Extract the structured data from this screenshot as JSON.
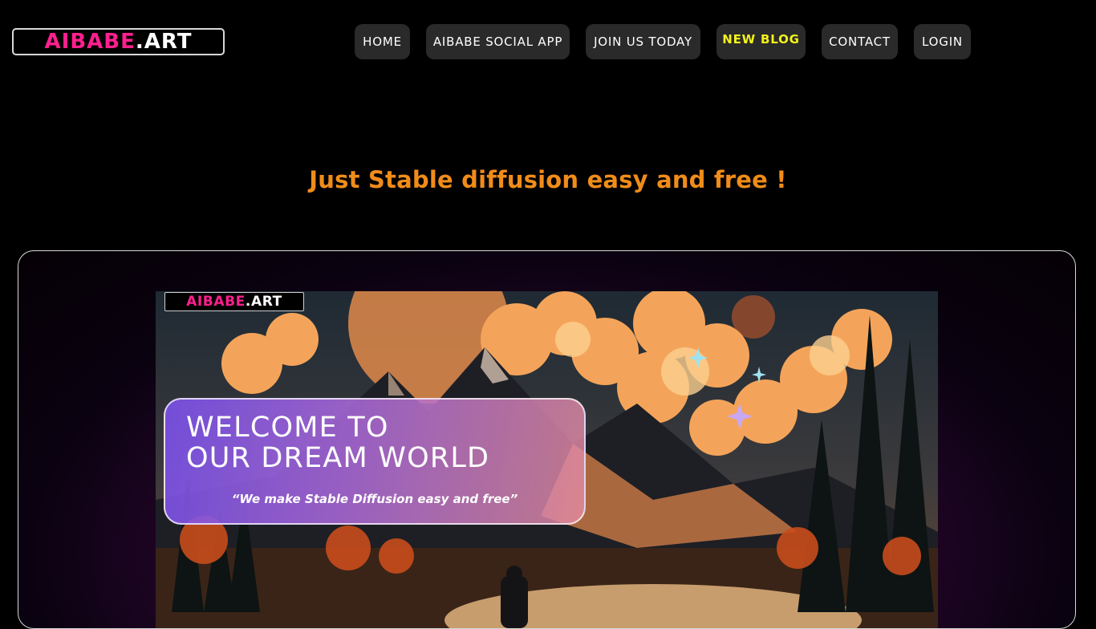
{
  "header": {
    "logo": {
      "part1": "AIBABE",
      "part2": ".ART"
    },
    "nav": [
      {
        "label": "HOME"
      },
      {
        "label": "AIBABE SOCIAL APP"
      },
      {
        "label": "JOIN US TODAY"
      },
      {
        "label": "NEW BLOG"
      },
      {
        "label": "CONTACT"
      },
      {
        "label": "LOGIN"
      }
    ]
  },
  "main": {
    "tagline": "Just Stable diffusion easy and free !",
    "hero": {
      "logo": {
        "part1": "AIBABE",
        "part2": ".ART"
      },
      "title_line1": "WELCOME TO",
      "title_line2": "OUR DREAM WORLD",
      "subtitle": "“We make Stable Diffusion easy and free”"
    }
  },
  "colors": {
    "background": "#000000",
    "tagline": "#f08c1a",
    "logo_pink": "#ff1f8e",
    "nav_button": "#2a2a2a",
    "blog_highlight": "#f3f21c"
  }
}
